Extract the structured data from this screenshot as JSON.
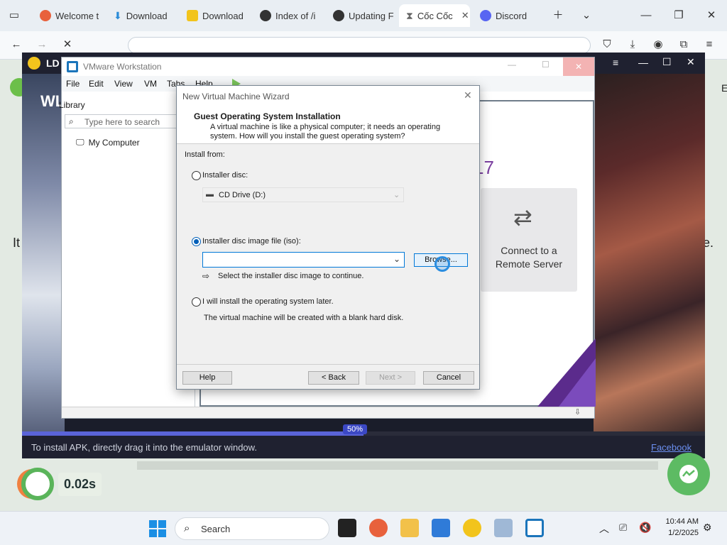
{
  "browser": {
    "tabs": [
      {
        "label": "Welcome t",
        "icon": "firefox-icon",
        "color": "#e8613c"
      },
      {
        "label": "Download",
        "icon": "download-icon",
        "color": "#2a8bd8"
      },
      {
        "label": "Download",
        "icon": "ld-icon",
        "color": "#f2c41c"
      },
      {
        "label": "Index of /i",
        "icon": "github-icon",
        "color": "#333333"
      },
      {
        "label": "Updating F",
        "icon": "github-icon",
        "color": "#333333"
      },
      {
        "label": "Cốc Cốc",
        "icon": "hourglass-icon",
        "color": "#666666"
      },
      {
        "label": "Discord",
        "icon": "discord-icon",
        "color": "#5865f2"
      }
    ]
  },
  "page": {
    "left_text": "It",
    "right_text": "e.",
    "right_char": "E",
    "speed_value": "0.02s"
  },
  "emulator": {
    "title": "LD",
    "bottom_hint": "To install APK, directly drag it into the emulator window.",
    "facebook_link": "Facebook",
    "progress_label": "50%",
    "progress": 0.5,
    "side_label": "WL"
  },
  "vmware": {
    "title": "VMware Workstation",
    "menu": [
      "File",
      "Edit",
      "View",
      "VM",
      "Tabs",
      "Help"
    ],
    "library_label": "Library",
    "search_placeholder": "Type here to search",
    "tree_item": "My Computer",
    "brand_version": "17",
    "remote_tile": {
      "line1": "Connect to a",
      "line2": "Remote Server"
    }
  },
  "wizard": {
    "title": "New Virtual Machine Wizard",
    "heading": "Guest Operating System Installation",
    "description": "A virtual machine is like a physical computer; it needs an operating system. How will you install the guest operating system?",
    "install_from": "Install from:",
    "opt_disc": "Installer disc:",
    "cd_drive": "CD Drive (D:)",
    "opt_iso": "Installer disc image file (iso):",
    "iso_value": "",
    "browse": "Browse...",
    "hint": "Select the installer disc image to continue.",
    "opt_later": "I will install the operating system later.",
    "later_desc": "The virtual machine will be created with a blank hard disk.",
    "selected_option": "iso",
    "buttons": {
      "help": "Help",
      "back": "< Back",
      "next": "Next >",
      "cancel": "Cancel"
    }
  },
  "taskbar": {
    "search_label": "Search",
    "time": "10:44 AM",
    "date": "1/2/2025"
  }
}
